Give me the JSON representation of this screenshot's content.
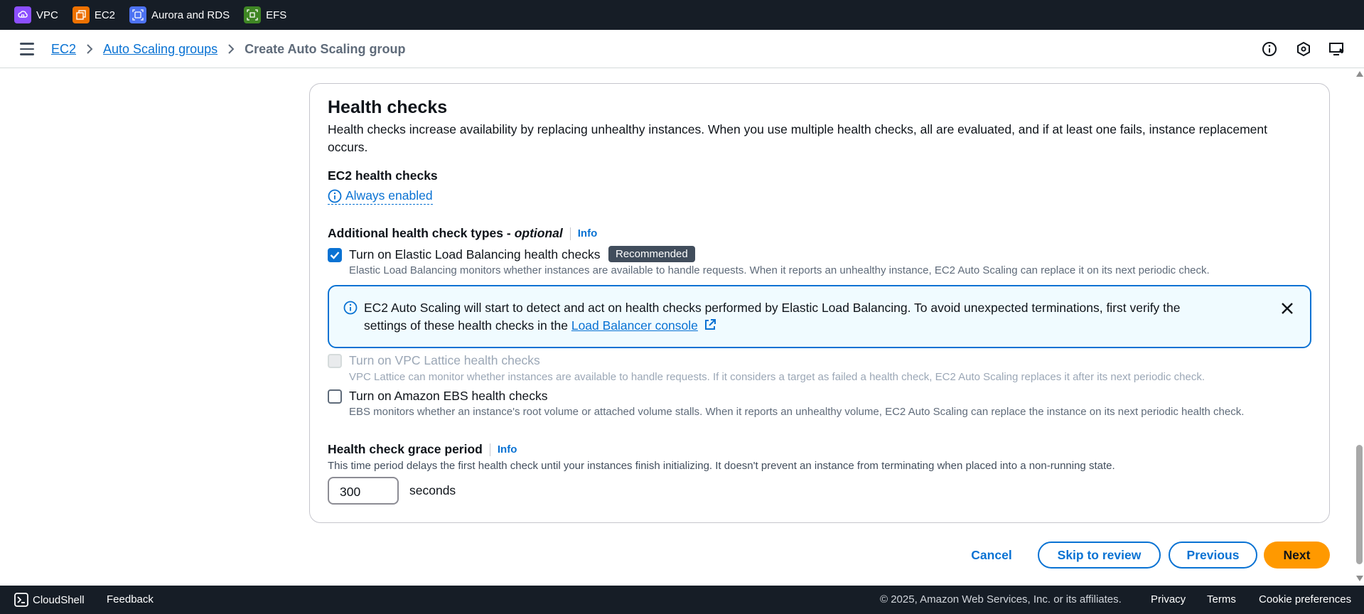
{
  "top_services": [
    {
      "label": "VPC",
      "icon": "vpc-icon",
      "color": "#8c4fff"
    },
    {
      "label": "EC2",
      "icon": "ec2-icon",
      "color": "#ed7100"
    },
    {
      "label": "Aurora and RDS",
      "icon": "rds-icon",
      "color": "#4d72f3"
    },
    {
      "label": "EFS",
      "icon": "efs-icon",
      "color": "#3f8624"
    }
  ],
  "breadcrumb": {
    "items": [
      "EC2",
      "Auto Scaling groups"
    ],
    "current": "Create Auto Scaling group"
  },
  "header_icons": [
    "info-icon",
    "settings-hexagon-icon",
    "remote-display-icon"
  ],
  "health_checks": {
    "title": "Health checks",
    "description": "Health checks increase availability by replacing unhealthy instances. When you use multiple health checks, all are evaluated, and if at least one fails, instance replacement occurs.",
    "ec2_label": "EC2 health checks",
    "ec2_status": "Always enabled",
    "additional_label": "Additional health check types - ",
    "additional_optional": "optional",
    "info": "Info",
    "elb": {
      "label": "Turn on Elastic Load Balancing health checks",
      "badge": "Recommended",
      "desc": "Elastic Load Balancing monitors whether instances are available to handle requests. When it reports an unhealthy instance, EC2 Auto Scaling can replace it on its next periodic check.",
      "checked": true
    },
    "alert": {
      "text": "EC2 Auto Scaling will start to detect and act on health checks performed by Elastic Load Balancing. To avoid unexpected terminations, first verify the settings of these health checks in the ",
      "link": "Load Balancer console"
    },
    "vpc_lattice": {
      "label": "Turn on VPC Lattice health checks",
      "desc": "VPC Lattice can monitor whether instances are available to handle requests. If it considers a target as failed a health check, EC2 Auto Scaling replaces it after its next periodic check.",
      "checked": false,
      "disabled": true
    },
    "ebs": {
      "label": "Turn on Amazon EBS health checks",
      "desc": "EBS monitors whether an instance's root volume or attached volume stalls. When it reports an unhealthy volume, EC2 Auto Scaling can replace the instance on its next periodic health check.",
      "checked": false
    },
    "grace_period": {
      "label": "Health check grace period",
      "info": "Info",
      "desc": "This time period delays the first health check until your instances finish initializing. It doesn't prevent an instance from terminating when placed into a non-running state.",
      "value": "300",
      "unit": "seconds"
    }
  },
  "actions": {
    "cancel": "Cancel",
    "skip": "Skip to review",
    "previous": "Previous",
    "next": "Next"
  },
  "footer": {
    "cloudshell": "CloudShell",
    "feedback": "Feedback",
    "copyright": "© 2025, Amazon Web Services, Inc. or its affiliates.",
    "privacy": "Privacy",
    "terms": "Terms",
    "cookies": "Cookie preferences"
  },
  "colors": {
    "accent": "#0972d3",
    "primary_button": "#ff9900",
    "nav_bg": "#161d26"
  }
}
